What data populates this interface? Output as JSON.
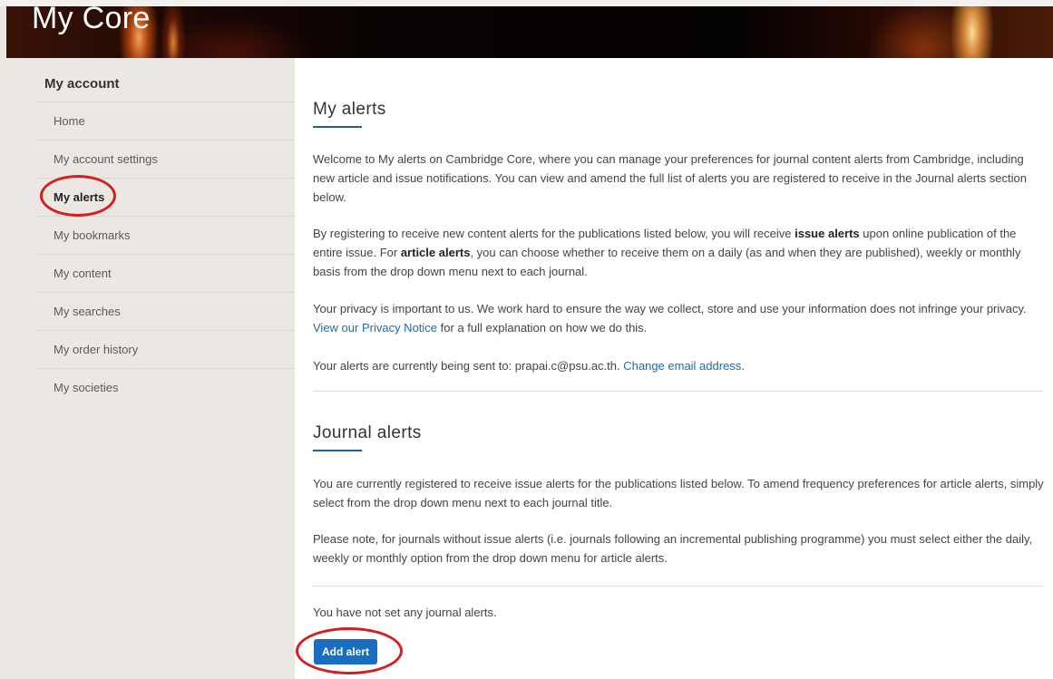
{
  "header": {
    "title": "My Core"
  },
  "sidebar": {
    "heading": "My account",
    "items": [
      {
        "label": "Home"
      },
      {
        "label": "My account settings"
      },
      {
        "label": "My alerts"
      },
      {
        "label": "My bookmarks"
      },
      {
        "label": "My content"
      },
      {
        "label": "My searches"
      },
      {
        "label": "My order history"
      },
      {
        "label": "My societies"
      }
    ],
    "active_item": "My alerts"
  },
  "main": {
    "my_alerts": {
      "title": "My alerts",
      "intro": "Welcome to My alerts on Cambridge Core, where you can manage your preferences for journal content alerts from Cambridge, including new article and issue notifications. You can view and amend the full list of alerts you are registered to receive in the Journal alerts section below.",
      "registering": {
        "part1": "By registering to receive new content alerts for the publications listed below, you will receive ",
        "bold1": "issue alerts",
        "part2": " upon online publication of the entire issue. For ",
        "bold2": "article alerts",
        "part3": ", you can choose whether to receive them on a daily (as and when they are published), weekly or monthly basis from the drop down menu next to each journal."
      },
      "privacy": {
        "part1": "Your privacy is important to us. We work hard to ensure the way we collect, store and use your information does not infringe your privacy. ",
        "link": "View our Privacy Notice",
        "part2": " for a full explanation on how we do this."
      },
      "email": {
        "part1": "Your alerts are currently being sent to: prapai.c@psu.ac.th. ",
        "link": "Change email address",
        "part2": "."
      }
    },
    "journal_alerts": {
      "title": "Journal alerts",
      "para1": "You are currently registered to receive issue alerts for the publications listed below. To amend frequency preferences for article alerts, simply select from the drop down menu next to each journal title.",
      "para2": "Please note, for journals without issue alerts (i.e. journals following an incremental publishing programme) you must select either the daily, weekly or monthly option from the drop down menu for article alerts.",
      "empty_message": "You have not set any journal alerts.",
      "add_button": "Add alert"
    }
  },
  "colors": {
    "link": "#1e6ba8",
    "button": "#1a6ec2",
    "title_underline": "#1e5f95",
    "annotation": "#d31f1f"
  }
}
